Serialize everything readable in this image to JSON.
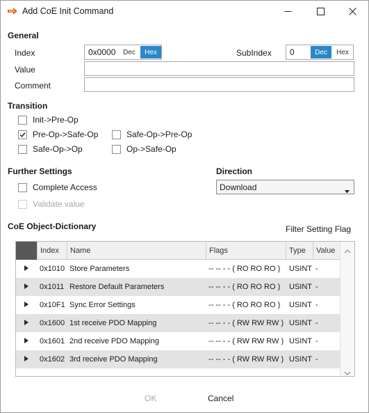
{
  "window": {
    "title": "Add CoE Init Command",
    "icon": "double-arrow-icon",
    "accent_color": "#2a88c9"
  },
  "general": {
    "heading": "General",
    "index_label": "Index",
    "index_value": "0x0000",
    "index_dec": "Dec",
    "index_hex": "Hex",
    "index_mode": "Hex",
    "subindex_label": "SubIndex",
    "subindex_value": "0",
    "subindex_dec": "Dec",
    "subindex_hex": "Hex",
    "subindex_mode": "Dec",
    "value_label": "Value",
    "value_value": "",
    "comment_label": "Comment",
    "comment_value": ""
  },
  "transition": {
    "heading": "Transition",
    "items": [
      {
        "label": "Init->Pre-Op",
        "checked": false
      },
      {
        "label": "Pre-Op->Safe-Op",
        "checked": true
      },
      {
        "label": "Safe-Op->Pre-Op",
        "checked": false
      },
      {
        "label": "Safe-Op->Op",
        "checked": false
      },
      {
        "label": "Op->Safe-Op",
        "checked": false
      }
    ]
  },
  "further": {
    "heading": "Further Settings",
    "complete_access": "Complete Access",
    "complete_access_checked": false,
    "validate_value": "Validate value",
    "validate_value_enabled": false
  },
  "direction": {
    "heading": "Direction",
    "selected": "Download"
  },
  "dictionary": {
    "heading": "CoE Object-Dictionary",
    "filter_label": "Filter Setting Flag",
    "columns": [
      "Index",
      "Name",
      "Flags",
      "Type",
      "Value"
    ],
    "rows": [
      {
        "index": "0x1010",
        "name": "Store Parameters",
        "flags": "-- -- - - ( RO RO RO )",
        "type": "USINT",
        "value": "-"
      },
      {
        "index": "0x1011",
        "name": "Restore Default Parameters",
        "flags": "-- -- - - ( RO RO RO )",
        "type": "USINT",
        "value": "-"
      },
      {
        "index": "0x10F1",
        "name": "Sync Error Settings",
        "flags": "-- -- - - ( RO RO RO )",
        "type": "USINT",
        "value": "-"
      },
      {
        "index": "0x1600",
        "name": "1st receive PDO Mapping",
        "flags": "-- -- - - ( RW RW RW )",
        "type": "USINT",
        "value": "-"
      },
      {
        "index": "0x1601",
        "name": "2nd receive PDO Mapping",
        "flags": "-- -- - - ( RW RW RW )",
        "type": "USINT",
        "value": "-"
      },
      {
        "index": "0x1602",
        "name": "3rd receive PDO Mapping",
        "flags": "-- -- - - ( RW RW RW )",
        "type": "USINT",
        "value": "-"
      }
    ]
  },
  "footer": {
    "ok_label": "OK",
    "ok_enabled": false,
    "cancel_label": "Cancel"
  }
}
